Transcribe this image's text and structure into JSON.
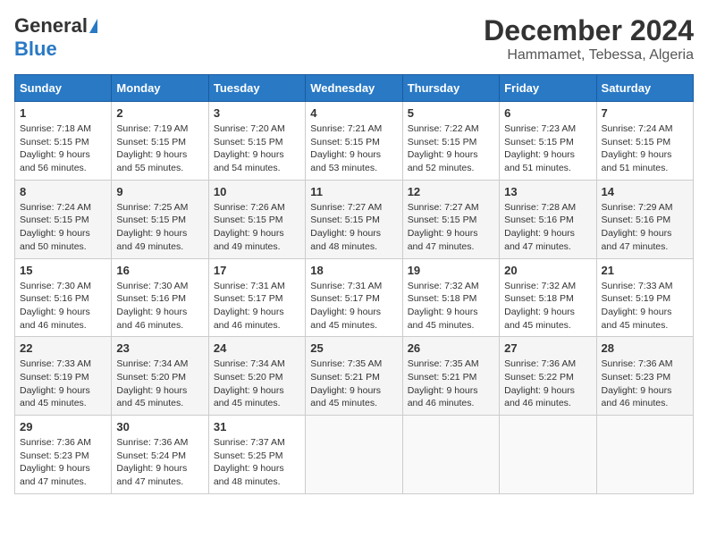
{
  "logo": {
    "general": "General",
    "blue": "Blue"
  },
  "title": "December 2024",
  "subtitle": "Hammamet, Tebessa, Algeria",
  "days_of_week": [
    "Sunday",
    "Monday",
    "Tuesday",
    "Wednesday",
    "Thursday",
    "Friday",
    "Saturday"
  ],
  "weeks": [
    [
      {
        "day": "1",
        "sunrise": "7:18 AM",
        "sunset": "5:15 PM",
        "daylight": "9 hours and 56 minutes."
      },
      {
        "day": "2",
        "sunrise": "7:19 AM",
        "sunset": "5:15 PM",
        "daylight": "9 hours and 55 minutes."
      },
      {
        "day": "3",
        "sunrise": "7:20 AM",
        "sunset": "5:15 PM",
        "daylight": "9 hours and 54 minutes."
      },
      {
        "day": "4",
        "sunrise": "7:21 AM",
        "sunset": "5:15 PM",
        "daylight": "9 hours and 53 minutes."
      },
      {
        "day": "5",
        "sunrise": "7:22 AM",
        "sunset": "5:15 PM",
        "daylight": "9 hours and 52 minutes."
      },
      {
        "day": "6",
        "sunrise": "7:23 AM",
        "sunset": "5:15 PM",
        "daylight": "9 hours and 51 minutes."
      },
      {
        "day": "7",
        "sunrise": "7:24 AM",
        "sunset": "5:15 PM",
        "daylight": "9 hours and 51 minutes."
      }
    ],
    [
      {
        "day": "8",
        "sunrise": "7:24 AM",
        "sunset": "5:15 PM",
        "daylight": "9 hours and 50 minutes."
      },
      {
        "day": "9",
        "sunrise": "7:25 AM",
        "sunset": "5:15 PM",
        "daylight": "9 hours and 49 minutes."
      },
      {
        "day": "10",
        "sunrise": "7:26 AM",
        "sunset": "5:15 PM",
        "daylight": "9 hours and 49 minutes."
      },
      {
        "day": "11",
        "sunrise": "7:27 AM",
        "sunset": "5:15 PM",
        "daylight": "9 hours and 48 minutes."
      },
      {
        "day": "12",
        "sunrise": "7:27 AM",
        "sunset": "5:15 PM",
        "daylight": "9 hours and 47 minutes."
      },
      {
        "day": "13",
        "sunrise": "7:28 AM",
        "sunset": "5:16 PM",
        "daylight": "9 hours and 47 minutes."
      },
      {
        "day": "14",
        "sunrise": "7:29 AM",
        "sunset": "5:16 PM",
        "daylight": "9 hours and 47 minutes."
      }
    ],
    [
      {
        "day": "15",
        "sunrise": "7:30 AM",
        "sunset": "5:16 PM",
        "daylight": "9 hours and 46 minutes."
      },
      {
        "day": "16",
        "sunrise": "7:30 AM",
        "sunset": "5:16 PM",
        "daylight": "9 hours and 46 minutes."
      },
      {
        "day": "17",
        "sunrise": "7:31 AM",
        "sunset": "5:17 PM",
        "daylight": "9 hours and 46 minutes."
      },
      {
        "day": "18",
        "sunrise": "7:31 AM",
        "sunset": "5:17 PM",
        "daylight": "9 hours and 45 minutes."
      },
      {
        "day": "19",
        "sunrise": "7:32 AM",
        "sunset": "5:18 PM",
        "daylight": "9 hours and 45 minutes."
      },
      {
        "day": "20",
        "sunrise": "7:32 AM",
        "sunset": "5:18 PM",
        "daylight": "9 hours and 45 minutes."
      },
      {
        "day": "21",
        "sunrise": "7:33 AM",
        "sunset": "5:19 PM",
        "daylight": "9 hours and 45 minutes."
      }
    ],
    [
      {
        "day": "22",
        "sunrise": "7:33 AM",
        "sunset": "5:19 PM",
        "daylight": "9 hours and 45 minutes."
      },
      {
        "day": "23",
        "sunrise": "7:34 AM",
        "sunset": "5:20 PM",
        "daylight": "9 hours and 45 minutes."
      },
      {
        "day": "24",
        "sunrise": "7:34 AM",
        "sunset": "5:20 PM",
        "daylight": "9 hours and 45 minutes."
      },
      {
        "day": "25",
        "sunrise": "7:35 AM",
        "sunset": "5:21 PM",
        "daylight": "9 hours and 45 minutes."
      },
      {
        "day": "26",
        "sunrise": "7:35 AM",
        "sunset": "5:21 PM",
        "daylight": "9 hours and 46 minutes."
      },
      {
        "day": "27",
        "sunrise": "7:36 AM",
        "sunset": "5:22 PM",
        "daylight": "9 hours and 46 minutes."
      },
      {
        "day": "28",
        "sunrise": "7:36 AM",
        "sunset": "5:23 PM",
        "daylight": "9 hours and 46 minutes."
      }
    ],
    [
      {
        "day": "29",
        "sunrise": "7:36 AM",
        "sunset": "5:23 PM",
        "daylight": "9 hours and 47 minutes."
      },
      {
        "day": "30",
        "sunrise": "7:36 AM",
        "sunset": "5:24 PM",
        "daylight": "9 hours and 47 minutes."
      },
      {
        "day": "31",
        "sunrise": "7:37 AM",
        "sunset": "5:25 PM",
        "daylight": "9 hours and 48 minutes."
      },
      null,
      null,
      null,
      null
    ]
  ],
  "labels": {
    "sunrise": "Sunrise:",
    "sunset": "Sunset:",
    "daylight": "Daylight:"
  }
}
